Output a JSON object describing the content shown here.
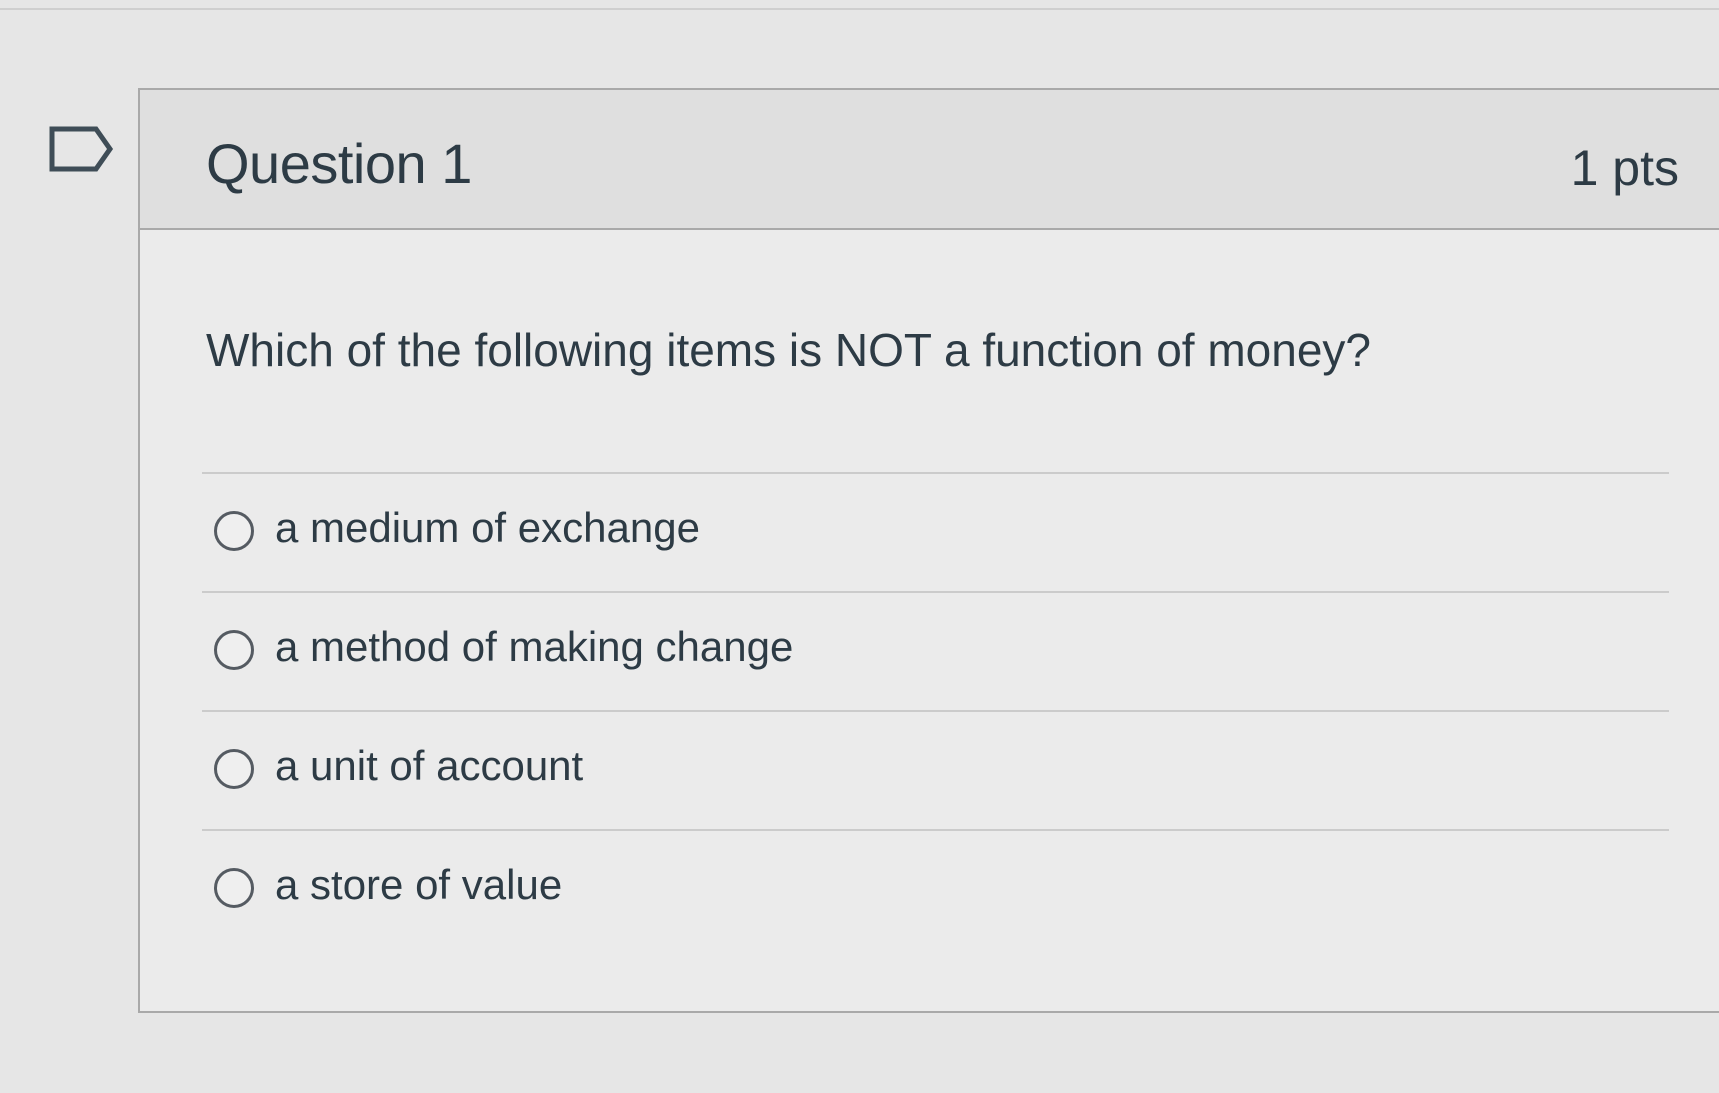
{
  "question": {
    "title": "Question 1",
    "points": "1 pts",
    "text": "Which of the following items is NOT a function of money?",
    "flag_icon": "flag-icon",
    "answers": [
      {
        "label": "a medium of exchange",
        "selected": false
      },
      {
        "label": "a method of making change",
        "selected": false
      },
      {
        "label": "a unit of account",
        "selected": false
      },
      {
        "label": "a store of value",
        "selected": false
      }
    ]
  },
  "colors": {
    "background": "#e6e6e6",
    "header_background": "#dfdfdf",
    "text": "#2d3b45",
    "border": "#a9a9a9"
  }
}
